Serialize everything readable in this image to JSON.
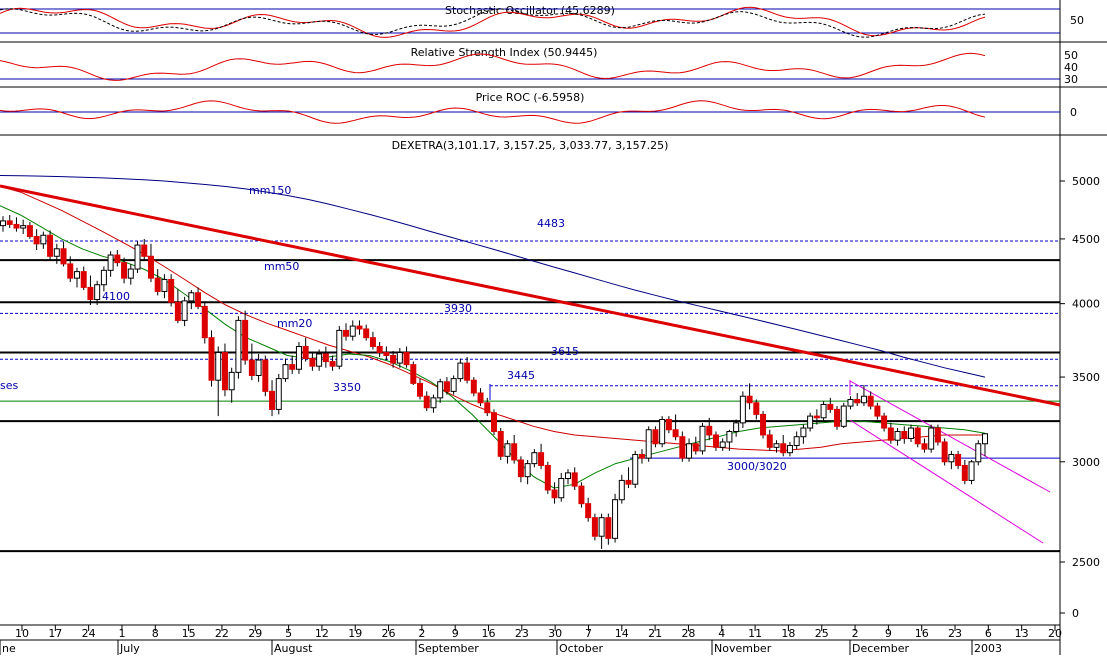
{
  "chart_data": {
    "type": "candlestick",
    "main_title": "DEXETRA(3,101.17, 3,157.25, 3,033.77, 3,157.25)",
    "panels": {
      "stochastic": {
        "title": "Stochastic Oscillator (45.6289)",
        "ticks": [
          "50"
        ]
      },
      "rsi": {
        "title": "Relative Strength Index (50.9445)",
        "ticks": [
          "50",
          "40",
          "30"
        ]
      },
      "roc": {
        "title": "Price ROC (-6.5958)",
        "ticks": [
          "0"
        ]
      }
    },
    "price_axis": {
      "ticks": [
        5000,
        4500,
        4000,
        3500,
        3000,
        2500,
        0
      ],
      "ylim": [
        2400,
        5200
      ]
    },
    "x_axis": {
      "day_labels": [
        "10",
        "17",
        "24",
        "1",
        "8",
        "15",
        "22",
        "29",
        "5",
        "12",
        "19",
        "26",
        "2",
        "9",
        "16",
        "23",
        "30",
        "7",
        "14",
        "21",
        "28",
        "4",
        "11",
        "18",
        "25",
        "2",
        "9",
        "16",
        "23",
        "6",
        "13",
        "20"
      ],
      "month_labels": [
        "ne",
        "July",
        "August",
        "September",
        "October",
        "November",
        "December",
        "2003"
      ]
    },
    "annotations": {
      "mm150": "mm150",
      "mm50": "mm50",
      "mm20": "mm20",
      "level_4483": "4483",
      "level_3930": "3930",
      "level_3615": "3615",
      "level_3445": "3445",
      "level_4100": "4100",
      "level_3350": "3350",
      "level_3000": "3000/3020",
      "left_edge": "ses"
    },
    "horizontal_levels": [
      {
        "value": 4483,
        "style": "dashed",
        "color": "#0000cc"
      },
      {
        "value": 3930,
        "style": "dashed",
        "color": "#0000cc"
      },
      {
        "value": 3615,
        "style": "dashed",
        "color": "#0000cc"
      },
      {
        "value": 3445,
        "style": "dashed",
        "color": "#0000cc"
      },
      {
        "value": 4330,
        "style": "solid",
        "color": "#000000"
      },
      {
        "value": 4010,
        "style": "solid",
        "color": "#000000"
      },
      {
        "value": 3660,
        "style": "solid",
        "color": "#000000"
      },
      {
        "value": 3230,
        "style": "solid",
        "color": "#000000"
      },
      {
        "value": 2550,
        "style": "solid",
        "color": "#000000"
      },
      {
        "value": 3020,
        "style": "solid",
        "color": "#0000cc"
      },
      {
        "value": 3350,
        "style": "solid",
        "color": "#008000"
      }
    ],
    "candles": [
      [
        4610,
        4690,
        4560,
        4650
      ],
      [
        4650,
        4700,
        4590,
        4620
      ],
      [
        4620,
        4680,
        4560,
        4590
      ],
      [
        4590,
        4660,
        4540,
        4610
      ],
      [
        4610,
        4640,
        4500,
        4520
      ],
      [
        4520,
        4580,
        4410,
        4460
      ],
      [
        4460,
        4560,
        4420,
        4530
      ],
      [
        4530,
        4570,
        4330,
        4360
      ],
      [
        4360,
        4460,
        4300,
        4420
      ],
      [
        4420,
        4480,
        4280,
        4300
      ],
      [
        4300,
        4360,
        4160,
        4190
      ],
      [
        4190,
        4270,
        4120,
        4240
      ],
      [
        4240,
        4280,
        4100,
        4120
      ],
      [
        4120,
        4210,
        3990,
        4030
      ],
      [
        4030,
        4170,
        3990,
        4140
      ],
      [
        4140,
        4280,
        4090,
        4250
      ],
      [
        4250,
        4400,
        4200,
        4370
      ],
      [
        4370,
        4410,
        4280,
        4310
      ],
      [
        4310,
        4350,
        4150,
        4190
      ],
      [
        4190,
        4300,
        4140,
        4260
      ],
      [
        4260,
        4480,
        4230,
        4450
      ],
      [
        4450,
        4500,
        4330,
        4360
      ],
      [
        4360,
        4460,
        4160,
        4190
      ],
      [
        4190,
        4260,
        4060,
        4090
      ],
      [
        4090,
        4220,
        4040,
        4180
      ],
      [
        4180,
        4220,
        3980,
        4010
      ],
      [
        4010,
        4110,
        3860,
        3880
      ],
      [
        3880,
        4050,
        3840,
        4020
      ],
      [
        4020,
        4100,
        3960,
        4080
      ],
      [
        4080,
        4120,
        3960,
        3980
      ],
      [
        3980,
        4010,
        3720,
        3760
      ],
      [
        3760,
        3810,
        3440,
        3480
      ],
      [
        3480,
        3700,
        3260,
        3660
      ],
      [
        3660,
        3720,
        3380,
        3420
      ],
      [
        3420,
        3560,
        3340,
        3530
      ],
      [
        3530,
        3910,
        3490,
        3880
      ],
      [
        3880,
        3950,
        3580,
        3610
      ],
      [
        3610,
        3720,
        3480,
        3510
      ],
      [
        3510,
        3650,
        3470,
        3610
      ],
      [
        3610,
        3640,
        3380,
        3410
      ],
      [
        3410,
        3480,
        3260,
        3300
      ],
      [
        3300,
        3520,
        3270,
        3490
      ],
      [
        3490,
        3620,
        3470,
        3580
      ],
      [
        3580,
        3640,
        3520,
        3550
      ],
      [
        3550,
        3730,
        3520,
        3700
      ],
      [
        3700,
        3760,
        3600,
        3620
      ],
      [
        3620,
        3660,
        3540,
        3570
      ],
      [
        3570,
        3680,
        3540,
        3650
      ],
      [
        3650,
        3700,
        3560,
        3600
      ],
      [
        3600,
        3640,
        3540,
        3570
      ],
      [
        3570,
        3840,
        3550,
        3810
      ],
      [
        3810,
        3860,
        3740,
        3770
      ],
      [
        3770,
        3880,
        3740,
        3840
      ],
      [
        3840,
        3880,
        3780,
        3820
      ],
      [
        3820,
        3850,
        3740,
        3760
      ],
      [
        3760,
        3800,
        3680,
        3700
      ],
      [
        3700,
        3730,
        3630,
        3660
      ],
      [
        3660,
        3700,
        3610,
        3640
      ],
      [
        3640,
        3670,
        3560,
        3590
      ],
      [
        3590,
        3690,
        3560,
        3660
      ],
      [
        3660,
        3700,
        3560,
        3580
      ],
      [
        3580,
        3600,
        3450,
        3460
      ],
      [
        3460,
        3490,
        3360,
        3380
      ],
      [
        3380,
        3410,
        3290,
        3310
      ],
      [
        3310,
        3390,
        3280,
        3370
      ],
      [
        3370,
        3490,
        3340,
        3470
      ],
      [
        3470,
        3500,
        3390,
        3410
      ],
      [
        3410,
        3510,
        3390,
        3490
      ],
      [
        3490,
        3620,
        3470,
        3590
      ],
      [
        3590,
        3630,
        3460,
        3480
      ],
      [
        3480,
        3500,
        3380,
        3400
      ],
      [
        3400,
        3430,
        3320,
        3340
      ],
      [
        3340,
        3370,
        3260,
        3280
      ],
      [
        3280,
        3300,
        3150,
        3170
      ],
      [
        3170,
        3190,
        3010,
        3030
      ],
      [
        3030,
        3120,
        2990,
        3100
      ],
      [
        3100,
        3150,
        2990,
        3010
      ],
      [
        3010,
        3030,
        2890,
        2920
      ],
      [
        2920,
        3010,
        2880,
        2990
      ],
      [
        2990,
        3070,
        2970,
        3050
      ],
      [
        3050,
        3100,
        2960,
        2980
      ],
      [
        2980,
        3000,
        2830,
        2850
      ],
      [
        2850,
        2890,
        2780,
        2810
      ],
      [
        2810,
        2940,
        2790,
        2910
      ],
      [
        2910,
        2960,
        2880,
        2940
      ],
      [
        2940,
        2970,
        2850,
        2870
      ],
      [
        2870,
        2890,
        2760,
        2780
      ],
      [
        2780,
        2810,
        2690,
        2710
      ],
      [
        2710,
        2730,
        2600,
        2620
      ],
      [
        2620,
        2730,
        2560,
        2710
      ],
      [
        2710,
        2730,
        2580,
        2610
      ],
      [
        2610,
        2830,
        2590,
        2800
      ],
      [
        2800,
        2930,
        2780,
        2900
      ],
      [
        2900,
        2970,
        2860,
        2880
      ],
      [
        2880,
        3060,
        2860,
        3040
      ],
      [
        3040,
        3070,
        2990,
        3020
      ],
      [
        3020,
        3200,
        3000,
        3180
      ],
      [
        3180,
        3200,
        3080,
        3100
      ],
      [
        3100,
        3260,
        3080,
        3240
      ],
      [
        3240,
        3260,
        3160,
        3180
      ],
      [
        3180,
        3270,
        3120,
        3140
      ],
      [
        3140,
        3170,
        3000,
        3020
      ],
      [
        3020,
        3130,
        3000,
        3100
      ],
      [
        3100,
        3140,
        3040,
        3060
      ],
      [
        3060,
        3220,
        3040,
        3200
      ],
      [
        3200,
        3250,
        3120,
        3150
      ],
      [
        3150,
        3170,
        3060,
        3080
      ],
      [
        3080,
        3130,
        3060,
        3110
      ],
      [
        3110,
        3180,
        3060,
        3170
      ],
      [
        3170,
        3240,
        3140,
        3220
      ],
      [
        3220,
        3410,
        3190,
        3380
      ],
      [
        3380,
        3460,
        3300,
        3340
      ],
      [
        3340,
        3360,
        3240,
        3270
      ],
      [
        3270,
        3290,
        3130,
        3150
      ],
      [
        3150,
        3180,
        3060,
        3080
      ],
      [
        3080,
        3120,
        3050,
        3100
      ],
      [
        3100,
        3150,
        3030,
        3050
      ],
      [
        3050,
        3110,
        3030,
        3090
      ],
      [
        3090,
        3170,
        3070,
        3140
      ],
      [
        3140,
        3210,
        3100,
        3190
      ],
      [
        3190,
        3280,
        3170,
        3260
      ],
      [
        3260,
        3300,
        3210,
        3250
      ],
      [
        3250,
        3350,
        3230,
        3330
      ],
      [
        3330,
        3370,
        3280,
        3300
      ],
      [
        3300,
        3320,
        3180,
        3200
      ],
      [
        3200,
        3340,
        3190,
        3320
      ],
      [
        3320,
        3380,
        3300,
        3360
      ],
      [
        3360,
        3400,
        3320,
        3340
      ],
      [
        3340,
        3450,
        3320,
        3380
      ],
      [
        3380,
        3410,
        3300,
        3320
      ],
      [
        3320,
        3340,
        3240,
        3260
      ],
      [
        3260,
        3280,
        3170,
        3190
      ],
      [
        3190,
        3220,
        3100,
        3120
      ],
      [
        3120,
        3190,
        3090,
        3170
      ],
      [
        3170,
        3200,
        3100,
        3130
      ],
      [
        3130,
        3210,
        3110,
        3190
      ],
      [
        3190,
        3200,
        3080,
        3100
      ],
      [
        3100,
        3130,
        3050,
        3070
      ],
      [
        3070,
        3210,
        3050,
        3190
      ],
      [
        3190,
        3210,
        3090,
        3110
      ],
      [
        3110,
        3130,
        2980,
        3000
      ],
      [
        3000,
        3060,
        2960,
        3040
      ],
      [
        3040,
        3060,
        2960,
        2980
      ],
      [
        2980,
        3010,
        2880,
        2900
      ],
      [
        2900,
        3010,
        2880,
        3000
      ],
      [
        3000,
        3120,
        2980,
        3100
      ],
      [
        3100,
        3160,
        3030,
        3157
      ]
    ],
    "series": [
      {
        "name": "mm150",
        "color": "#000080",
        "values": [
          5050,
          5048,
          5045,
          5040,
          5035,
          5028,
          5020,
          5012,
          5000,
          4985,
          4968,
          4950,
          4928,
          4900,
          4870,
          4835,
          4795,
          4750,
          4705,
          4658,
          4610,
          4560,
          4512,
          4465,
          4418,
          4370,
          4322,
          4275,
          4230,
          4185,
          4140,
          4098,
          4058,
          4020,
          3985,
          3950,
          3915,
          3880,
          3845,
          3810,
          3775,
          3740,
          3705,
          3670,
          3630,
          3595,
          3560,
          3530,
          3500
        ]
      },
      {
        "name": "mm50",
        "color": "#cc0000",
        "values": [
          4950,
          4900,
          4820,
          4740,
          4650,
          4560,
          4470,
          4380,
          4280,
          4180,
          4080,
          3990,
          3920,
          3860,
          3810,
          3760,
          3710,
          3670,
          3630,
          3580,
          3520,
          3460,
          3390,
          3330,
          3280,
          3240,
          3200,
          3170,
          3150,
          3140,
          3130,
          3120,
          3110,
          3100,
          3090,
          3080,
          3070,
          3065,
          3060,
          3070,
          3080,
          3100,
          3110,
          3120,
          3130,
          3140,
          3150,
          3150,
          3150
        ]
      },
      {
        "name": "mm20",
        "color": "#008000",
        "values": [
          4780,
          4700,
          4600,
          4500,
          4420,
          4360,
          4320,
          4260,
          4180,
          4070,
          3960,
          3850,
          3760,
          3700,
          3640,
          3620,
          3630,
          3650,
          3640,
          3600,
          3540,
          3470,
          3380,
          3270,
          3150,
          3030,
          2920,
          2860,
          2880,
          2940,
          2990,
          3020,
          3050,
          3080,
          3110,
          3140,
          3170,
          3190,
          3200,
          3210,
          3220,
          3230,
          3230,
          3220,
          3210,
          3200,
          3190,
          3180,
          3160
        ]
      }
    ],
    "roc_level_label": "0"
  }
}
